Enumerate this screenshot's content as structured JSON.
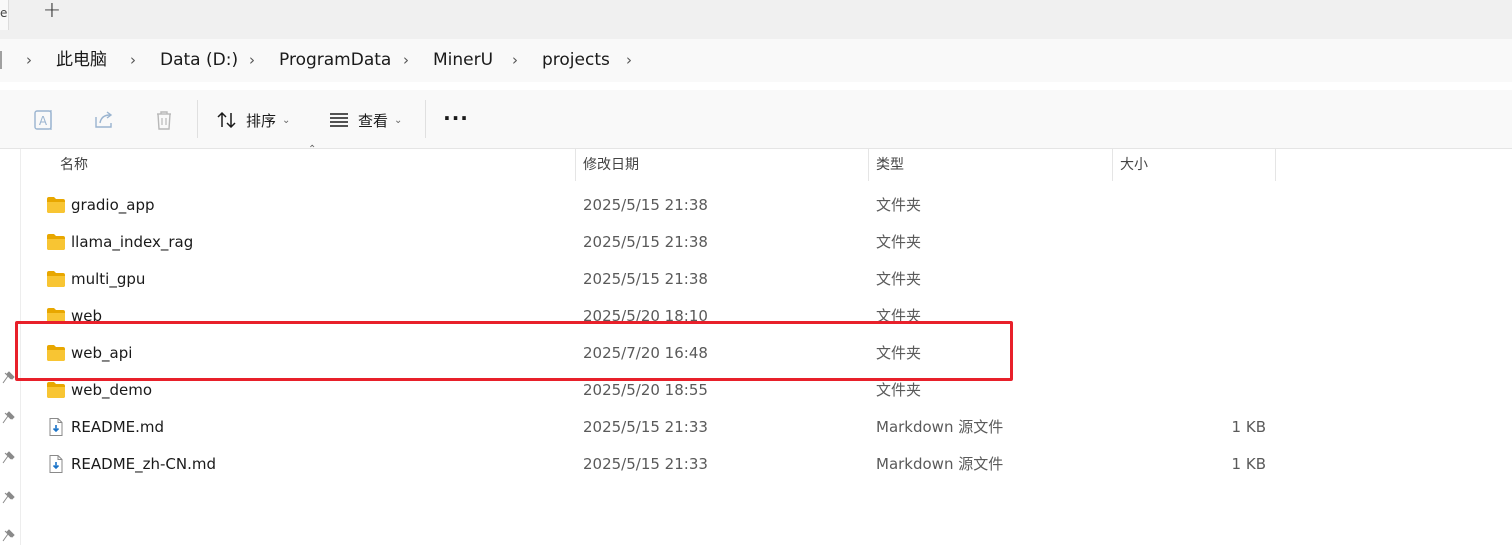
{
  "tabstrip": {
    "new_tab_glyph": "+",
    "left_edge_glyph": "e"
  },
  "breadcrumb": {
    "items": [
      "此电脑",
      "Data (D:)",
      "ProgramData",
      "MinerU",
      "projects"
    ],
    "separator": "›"
  },
  "commandbar": {
    "sort_label": "排序",
    "view_label": "查看",
    "more_label": "···",
    "icons": [
      "rename-icon",
      "share-icon",
      "delete-icon",
      "sort-icon",
      "view-icon"
    ]
  },
  "columns": {
    "name": "名称",
    "date": "修改日期",
    "type": "类型",
    "size": "大小"
  },
  "files": [
    {
      "name": "gradio_app",
      "date": "2025/5/15 21:38",
      "type": "文件夹",
      "size": "",
      "kind": "folder"
    },
    {
      "name": "llama_index_rag",
      "date": "2025/5/15 21:38",
      "type": "文件夹",
      "size": "",
      "kind": "folder"
    },
    {
      "name": "multi_gpu",
      "date": "2025/5/15 21:38",
      "type": "文件夹",
      "size": "",
      "kind": "folder"
    },
    {
      "name": "web",
      "date": "2025/5/20 18:10",
      "type": "文件夹",
      "size": "",
      "kind": "folder"
    },
    {
      "name": "web_api",
      "date": "2025/7/20 16:48",
      "type": "文件夹",
      "size": "",
      "kind": "folder"
    },
    {
      "name": "web_demo",
      "date": "2025/5/20 18:55",
      "type": "文件夹",
      "size": "",
      "kind": "folder"
    },
    {
      "name": "README.md",
      "date": "2025/5/15 21:33",
      "type": "Markdown 源文件",
      "size": "1 KB",
      "kind": "markdown"
    },
    {
      "name": "README_zh-CN.md",
      "date": "2025/5/15 21:33",
      "type": "Markdown 源文件",
      "size": "1 KB",
      "kind": "markdown"
    }
  ],
  "colors": {
    "folder": "#f8c533",
    "folder_dark": "#e8a700",
    "highlight": "#e8202a",
    "accent": "#1a73c8"
  }
}
